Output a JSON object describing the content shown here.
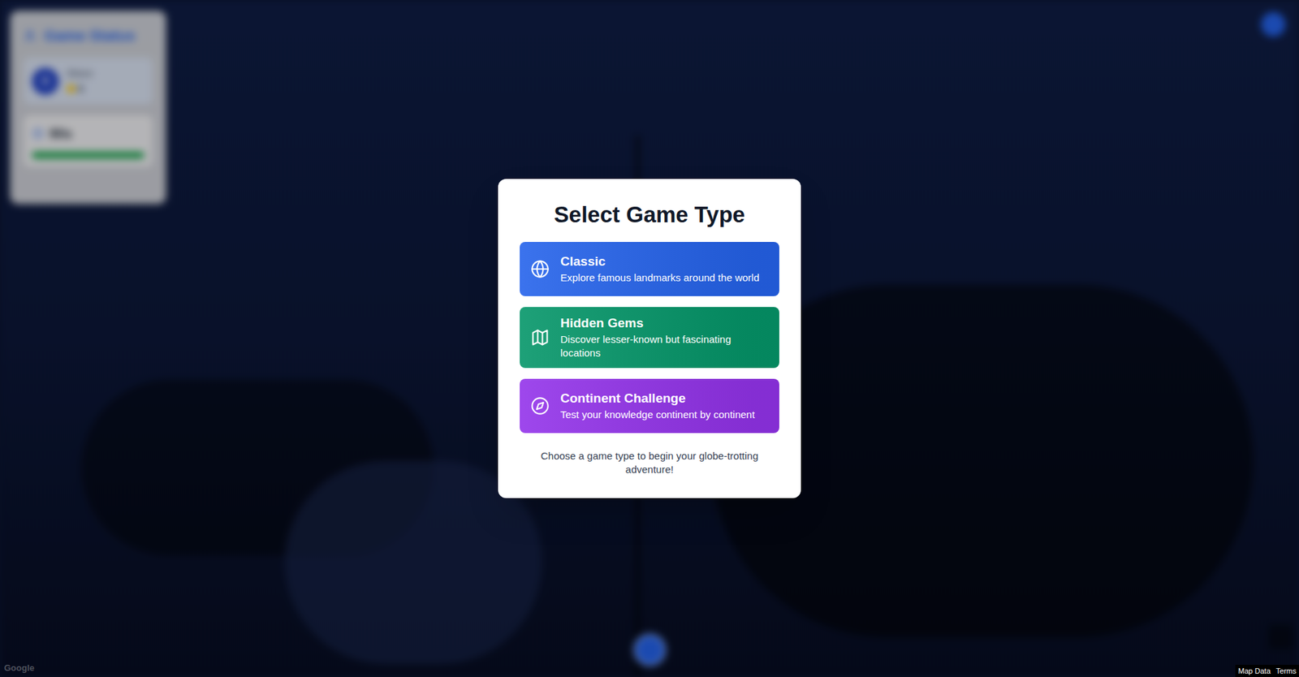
{
  "game_status": {
    "title": "Game Status",
    "player": {
      "avatar": "0",
      "name": "Disco",
      "score": "0"
    },
    "timer": {
      "reading": "90s",
      "level": 1
    }
  },
  "modal": {
    "title": "Select Game Type",
    "options": [
      {
        "label": "Classic",
        "description": "Explore famous landmarks around the world",
        "color": "#2563eb",
        "kind": "globe"
      },
      {
        "label": "Hidden Gems",
        "description": "Discover lesser-known but fascinating locations",
        "color": "#059669",
        "kind": "map"
      },
      {
        "label": "Continent Challenge",
        "description": "Test your knowledge continent by continent",
        "color": "#9333ea",
        "kind": "compass"
      }
    ],
    "footer": "Choose a game type to begin your globe-trotting adventure!"
  },
  "map": {
    "attribution": "Google",
    "links": [
      "Map Data",
      "Terms"
    ]
  }
}
